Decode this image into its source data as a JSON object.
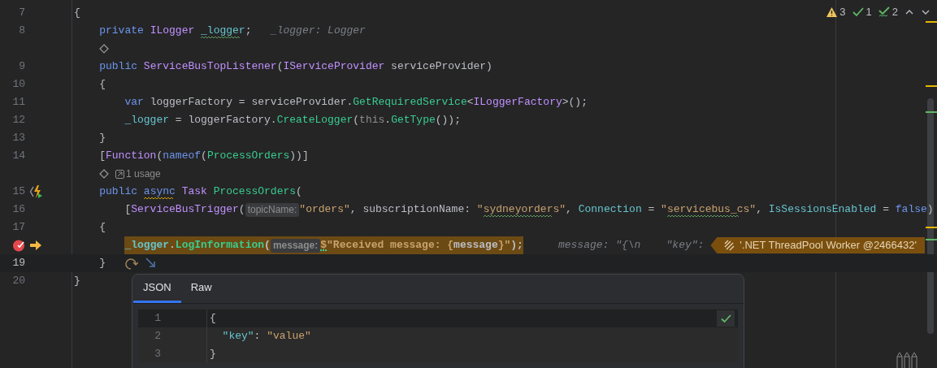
{
  "inspections": [
    {
      "kind": "warning",
      "count": "3"
    },
    {
      "kind": "ok",
      "count": "1"
    },
    {
      "kind": "typo",
      "count": "2"
    }
  ],
  "rows": [
    {
      "kind": "code",
      "number": "7",
      "current_line": false,
      "execution_line": false,
      "tokens": [
        {
          "text": "{",
          "kind": "plain"
        }
      ]
    },
    {
      "kind": "code",
      "number": "8",
      "current_line": false,
      "execution_line": false,
      "tokens": [
        {
          "text": "    private ",
          "kind": "keyword"
        },
        {
          "text": "ILogger ",
          "kind": "type"
        },
        {
          "text": "_logger",
          "kind": "field",
          "squiggle": {
            "kind": "wavy",
            "color": "#5d9a5d"
          }
        },
        {
          "text": ";   ",
          "kind": "plain"
        },
        {
          "text": "_logger: Logger",
          "kind": "inline-value"
        }
      ]
    },
    {
      "kind": "annotation"
    },
    {
      "kind": "code",
      "number": "9",
      "current_line": false,
      "execution_line": false,
      "tokens": [
        {
          "text": "    public ",
          "kind": "keyword"
        },
        {
          "text": "ServiceBusTopListener",
          "kind": "type"
        },
        {
          "text": "(",
          "kind": "plain"
        },
        {
          "text": "IServiceProvider",
          "kind": "type"
        },
        {
          "text": " serviceProvider)",
          "kind": "plain"
        }
      ]
    },
    {
      "kind": "code",
      "number": "10",
      "current_line": false,
      "execution_line": false,
      "tokens": [
        {
          "text": "    {",
          "kind": "plain"
        }
      ]
    },
    {
      "kind": "code",
      "number": "11",
      "current_line": false,
      "execution_line": false,
      "tokens": [
        {
          "text": "        var ",
          "kind": "keyword"
        },
        {
          "text": "loggerFactory = serviceProvider.",
          "kind": "plain"
        },
        {
          "text": "GetRequiredService",
          "kind": "method"
        },
        {
          "text": "<",
          "kind": "plain"
        },
        {
          "text": "ILoggerFactory",
          "kind": "type"
        },
        {
          "text": ">();",
          "kind": "plain"
        }
      ]
    },
    {
      "kind": "code",
      "number": "12",
      "current_line": false,
      "execution_line": false,
      "tokens": [
        {
          "text": "        _logger",
          "kind": "field"
        },
        {
          "text": " = loggerFactory.",
          "kind": "plain"
        },
        {
          "text": "CreateLogger",
          "kind": "method"
        },
        {
          "text": "(",
          "kind": "plain"
        },
        {
          "text": "this",
          "kind": "dim"
        },
        {
          "text": ".",
          "kind": "plain"
        },
        {
          "text": "GetType",
          "kind": "method"
        },
        {
          "text": "());",
          "kind": "plain"
        }
      ]
    },
    {
      "kind": "code",
      "number": "13",
      "current_line": false,
      "execution_line": false,
      "tokens": [
        {
          "text": "    }",
          "kind": "plain"
        }
      ]
    },
    {
      "kind": "code",
      "number": "14",
      "current_line": false,
      "execution_line": false,
      "tokens": [
        {
          "text": "    [",
          "kind": "plain"
        },
        {
          "text": "Function",
          "kind": "type"
        },
        {
          "text": "(",
          "kind": "plain"
        },
        {
          "text": "nameof",
          "kind": "keyword"
        },
        {
          "text": "(",
          "kind": "plain"
        },
        {
          "text": "ProcessOrders",
          "kind": "method"
        },
        {
          "text": "))]",
          "kind": "plain"
        }
      ]
    },
    {
      "kind": "annotation",
      "usage": "1 usage"
    },
    {
      "kind": "code",
      "number": "15",
      "current_line": false,
      "execution_line": false,
      "gutter": [
        {
          "kind": "function-run"
        }
      ],
      "tokens": [
        {
          "text": "    public ",
          "kind": "keyword"
        },
        {
          "text": "async",
          "kind": "keyword",
          "squiggle": {
            "kind": "wavy",
            "color": "#c9a000"
          }
        },
        {
          "text": " Task ",
          "kind": "type"
        },
        {
          "text": "ProcessOrders",
          "kind": "method"
        },
        {
          "text": "(",
          "kind": "plain"
        }
      ]
    },
    {
      "kind": "code",
      "number": "16",
      "current_line": false,
      "execution_line": false,
      "tokens": [
        {
          "text": "        [",
          "kind": "plain"
        },
        {
          "text": "ServiceBusTrigger",
          "kind": "type"
        },
        {
          "text": "(",
          "kind": "plain"
        },
        {
          "text": "topicName:",
          "kind": "hint"
        },
        {
          "text": "\"orders\"",
          "kind": "string"
        },
        {
          "text": ", subscriptionName: ",
          "kind": "plain"
        },
        {
          "text": "\"",
          "kind": "string"
        },
        {
          "text": "sydneyorders",
          "kind": "string",
          "squiggle": {
            "kind": "wavy",
            "color": "#5d9a5d"
          }
        },
        {
          "text": "\"",
          "kind": "string"
        },
        {
          "text": ", ",
          "kind": "plain"
        },
        {
          "text": "Connection",
          "kind": "field"
        },
        {
          "text": " = ",
          "kind": "plain"
        },
        {
          "text": "\"",
          "kind": "string"
        },
        {
          "text": "servicebus_cs",
          "kind": "string",
          "squiggle": {
            "kind": "wavy",
            "color": "#5d9a5d"
          }
        },
        {
          "text": "\"",
          "kind": "string"
        },
        {
          "text": ", ",
          "kind": "plain"
        },
        {
          "text": "IsSessionsEnabled",
          "kind": "field"
        },
        {
          "text": " = ",
          "kind": "plain"
        },
        {
          "text": "false",
          "kind": "keyword"
        },
        {
          "text": ")",
          "kind": "plain"
        }
      ]
    },
    {
      "kind": "code",
      "number": "17",
      "current_line": false,
      "execution_line": false,
      "tokens": [
        {
          "text": "    {",
          "kind": "plain"
        }
      ]
    },
    {
      "kind": "code",
      "current_line": false,
      "execution_line": true,
      "gutter": [
        {
          "kind": "breakpoint"
        },
        {
          "kind": "execution-arrow"
        }
      ],
      "tokens": [
        {
          "text": "        _logger",
          "kind": "field"
        },
        {
          "text": ".",
          "kind": "plain"
        },
        {
          "text": "LogInformation",
          "kind": "method"
        },
        {
          "text": "(",
          "kind": "plain"
        },
        {
          "text": "message:",
          "kind": "hint"
        },
        {
          "text": "$",
          "kind": "string",
          "squiggle": {
            "kind": "dotted",
            "color": "#39cc8f"
          }
        },
        {
          "text": "\"Received message: {",
          "kind": "string"
        },
        {
          "text": "message",
          "kind": "plain"
        },
        {
          "text": "}\"",
          "kind": "string"
        },
        {
          "text": ");",
          "kind": "plain"
        }
      ],
      "inline_value": "message: \"{\\n    \"key\":",
      "thread": "'.NET ThreadPool Worker @2466432'"
    },
    {
      "kind": "code",
      "number": "19",
      "current_line": true,
      "execution_line": false,
      "tokens": [
        {
          "text": "    }",
          "kind": "plain"
        }
      ],
      "actions": [
        {
          "kind": "step-over"
        },
        {
          "kind": "step-into"
        }
      ]
    },
    {
      "kind": "code",
      "number": "20",
      "current_line": false,
      "execution_line": false,
      "tokens": [
        {
          "text": "}",
          "kind": "plain"
        }
      ]
    }
  ],
  "popup": {
    "tabs": [
      {
        "label": "JSON",
        "selected": true
      },
      {
        "label": "Raw",
        "selected": false
      }
    ],
    "lines": [
      {
        "number": "1",
        "current_line": true,
        "tokens": [
          {
            "text": "{",
            "kind": "plain"
          }
        ]
      },
      {
        "number": "2",
        "current_line": false,
        "tokens": [
          {
            "text": "  \"key\"",
            "kind": "field"
          },
          {
            "text": ": ",
            "kind": "plain"
          },
          {
            "text": "\"value\"",
            "kind": "string"
          }
        ]
      },
      {
        "number": "3",
        "current_line": false,
        "tokens": [
          {
            "text": "}",
            "kind": "plain"
          }
        ]
      }
    ]
  }
}
